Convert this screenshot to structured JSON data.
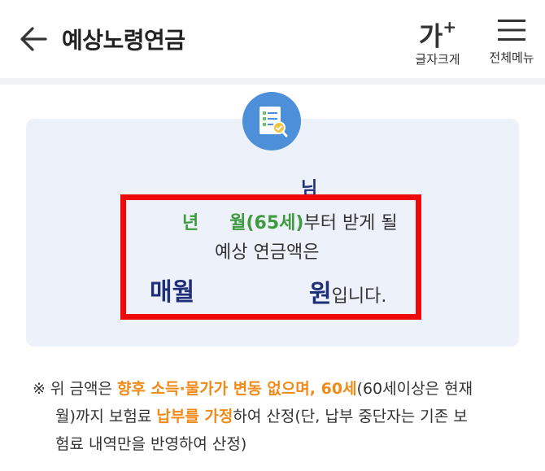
{
  "header": {
    "title": "예상노령연금",
    "font_size_glyph": "가",
    "font_size_sup": "+",
    "font_size_label": "글자크게",
    "menu_label": "전체메뉴"
  },
  "card": {
    "name_suffix": "님",
    "year_unit": "년",
    "month_age": "월(65세)",
    "from_receive": "부터 받게 될",
    "expected_amount": "예상 연금액은",
    "monthly": "매월",
    "won": "원",
    "ipnida": "입니다."
  },
  "notice": {
    "mark": "※",
    "p1": " 위 금액은 ",
    "h1": "향후 소득·물가가 변동 없으며, 60세",
    "p2": "(60세이상은 현재",
    "p3": "월)까지 보험료 ",
    "h2": "납부를 가정",
    "p4": "하여 산정(단, 납부 중단자는 기존 보",
    "p5": "험료 내역만을 반영하여 산정)"
  },
  "colors": {
    "accent_navy": "#1f2e78",
    "green": "#3e9a3e",
    "orange": "#f08a18",
    "highlight_red": "#ee0a0a",
    "icon_blue": "#4e8fd9",
    "card_bg": "#edf1f9"
  },
  "icons": [
    "arrow-left-icon",
    "hamburger-menu-icon",
    "document-check-icon"
  ]
}
